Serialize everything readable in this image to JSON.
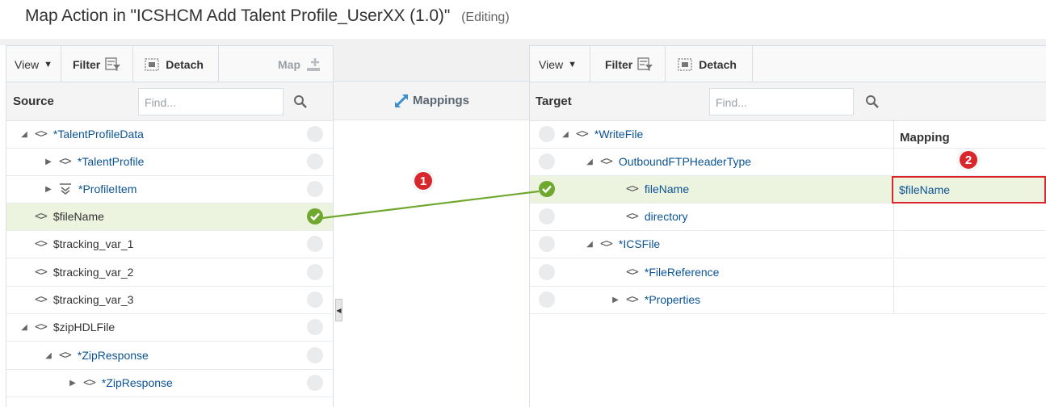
{
  "page": {
    "title": "Map Action in \"ICSHCM Add Talent Profile_UserXX (1.0)\"",
    "status": "(Editing)"
  },
  "source_toolbar": {
    "view": "View",
    "filter": "Filter",
    "detach": "Detach",
    "map": "Map"
  },
  "target_toolbar": {
    "view": "View",
    "filter": "Filter",
    "detach": "Detach"
  },
  "source": {
    "title": "Source",
    "find_placeholder": "Find...",
    "rows": [
      {
        "label": "TalentProfileData",
        "required": true,
        "expand": "expanded",
        "icon": "element-icon"
      },
      {
        "label": "TalentProfile",
        "required": true,
        "expand": "collapsed",
        "icon": "element-icon"
      },
      {
        "label": "ProfileItem",
        "required": true,
        "expand": "collapsed",
        "icon": "repeating-element-icon"
      },
      {
        "label": "$fileName",
        "required": false,
        "expand": "none",
        "icon": "element-icon",
        "mapped": true
      },
      {
        "label": "$tracking_var_1",
        "required": false,
        "expand": "none",
        "icon": "element-icon"
      },
      {
        "label": "$tracking_var_2",
        "required": false,
        "expand": "none",
        "icon": "element-icon"
      },
      {
        "label": "$tracking_var_3",
        "required": false,
        "expand": "none",
        "icon": "element-icon"
      },
      {
        "label": "$zipHDLFile",
        "required": false,
        "expand": "expanded",
        "icon": "element-icon"
      },
      {
        "label": "ZipResponse",
        "required": true,
        "expand": "expanded",
        "icon": "element-icon"
      },
      {
        "label": "ZipResponse",
        "required": true,
        "expand": "collapsed",
        "icon": "element-icon"
      }
    ]
  },
  "mappings": {
    "title": "Mappings"
  },
  "target": {
    "title": "Target",
    "find_placeholder": "Find...",
    "mapping_col": "Mapping",
    "rows": [
      {
        "label": "WriteFile",
        "required": true,
        "expand": "expanded",
        "mapping": ""
      },
      {
        "label": "OutboundFTPHeaderType",
        "required": false,
        "expand": "expanded",
        "mapping": ""
      },
      {
        "label": "fileName",
        "required": false,
        "expand": "none",
        "mapping": "$fileName",
        "mapped": true
      },
      {
        "label": "directory",
        "required": false,
        "expand": "none",
        "mapping": ""
      },
      {
        "label": "ICSFile",
        "required": true,
        "expand": "expanded",
        "mapping": ""
      },
      {
        "label": "FileReference",
        "required": true,
        "expand": "none",
        "mapping": ""
      },
      {
        "label": "Properties",
        "required": true,
        "expand": "collapsed",
        "mapping": ""
      }
    ]
  },
  "callouts": [
    "1",
    "2"
  ],
  "colors": {
    "mapped_green": "#6fa82e",
    "callout_red": "#d9262c",
    "link_blue": "#0b5394",
    "selected_row": "#ecf3de"
  }
}
